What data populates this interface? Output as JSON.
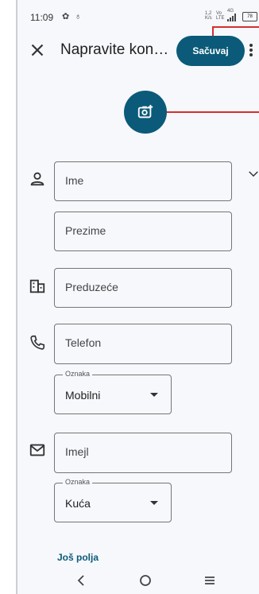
{
  "status_bar": {
    "time": "11:09",
    "speed_top": "1,2",
    "speed_bottom": "K/s",
    "volte_top": "Vo",
    "volte_bottom": "LTE",
    "network": "4G",
    "battery": "78"
  },
  "toolbar": {
    "title": "Napravite kontakt",
    "save_label": "Sačuvaj"
  },
  "form": {
    "first_name_placeholder": "Ime",
    "last_name_placeholder": "Prezime",
    "company_placeholder": "Preduzeće",
    "phone_placeholder": "Telefon",
    "phone_label_caption": "Oznaka",
    "phone_label_value": "Mobilni",
    "email_placeholder": "Imejl",
    "email_label_caption": "Oznaka",
    "email_label_value": "Kuća",
    "more_fields": "Još polja"
  },
  "icons": {
    "close": "close-icon",
    "more": "more-vert-icon",
    "add_photo": "add-photo-icon",
    "person": "person-icon",
    "company": "business-icon",
    "phone": "phone-icon",
    "email": "email-icon",
    "expand": "chevron-down-icon",
    "nav_back": "back-icon",
    "nav_home": "home-icon",
    "nav_recents": "recents-icon"
  },
  "colors": {
    "accent": "#0b5a79",
    "background": "#f6f8fc",
    "annotation": "#d32f2f"
  }
}
